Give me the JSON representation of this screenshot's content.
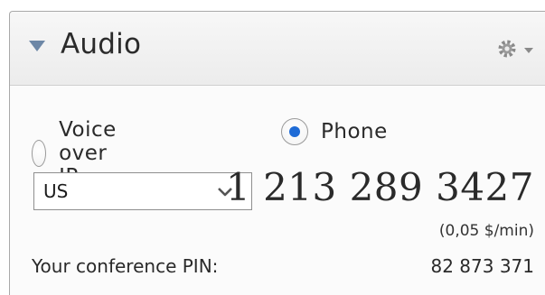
{
  "panel": {
    "title": "Audio",
    "collapse_icon": "triangle-down-icon",
    "settings_icon": "gear-dropdown-icon"
  },
  "audio_mode": {
    "options": [
      {
        "label": "Voice over IP",
        "selected": false
      },
      {
        "label": "Phone",
        "selected": true
      }
    ],
    "accent_color": "#1e6bd6"
  },
  "country": {
    "selected": "US",
    "chevron_icon": "chevron-down-icon"
  },
  "phone": {
    "number": "1 213 289 3427",
    "rate": "(0,05 $/min)"
  },
  "pin": {
    "label": "Your conference PIN:",
    "value": "82 873 371"
  }
}
